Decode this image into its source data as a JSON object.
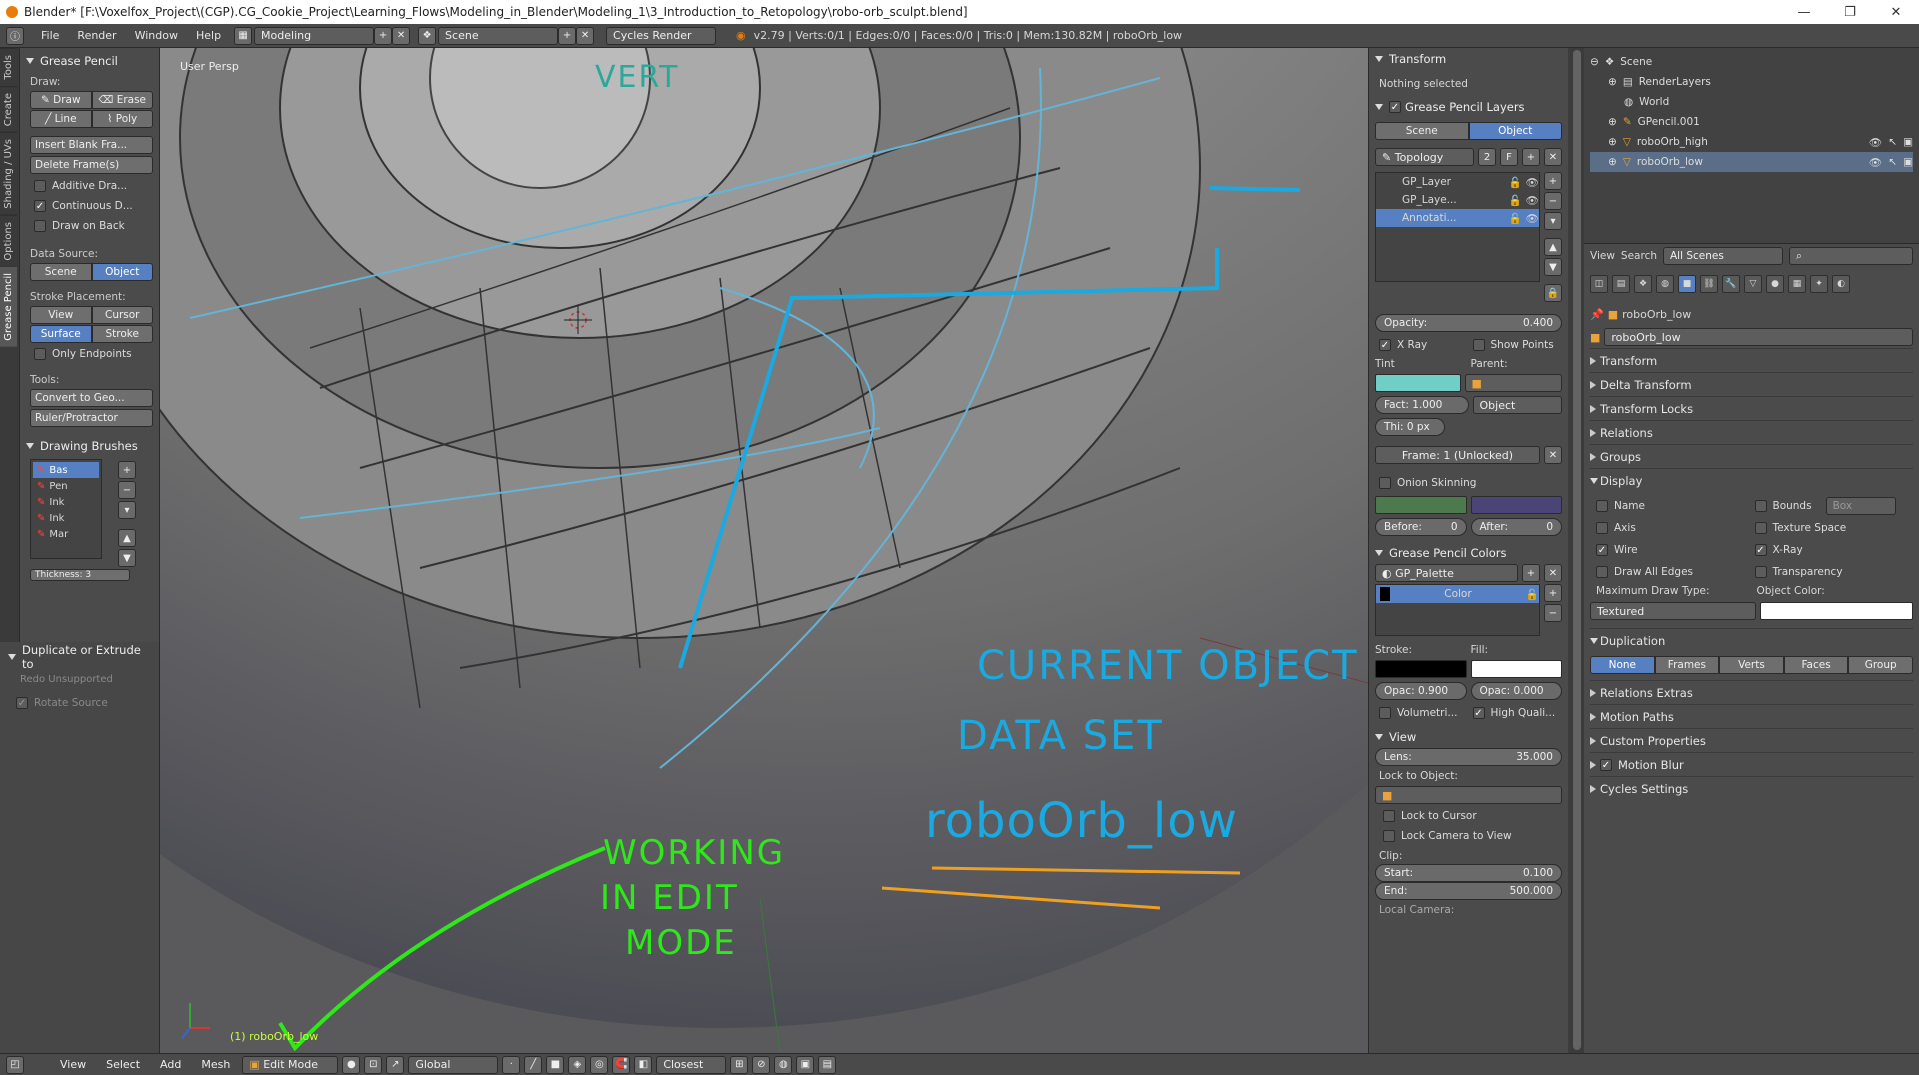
{
  "title_bar": {
    "text": "Blender* [F:\\Voxelfox_Project\\(CGP).CG_Cookie_Project\\Learning_Flows\\Modeling_in_Blender\\Modeling_1\\3_Introduction_to_Retopology\\robo-orb_sculpt.blend]",
    "min": "—",
    "max": "❐",
    "close": "✕"
  },
  "info_bar": {
    "menus": [
      "File",
      "Render",
      "Window",
      "Help"
    ],
    "layout": "Modeling",
    "scene": "Scene",
    "engine": "Cycles Render",
    "stats": "v2.79 | Verts:0/1 | Edges:0/0 | Faces:0/0 | Tris:0 | Mem:130.82M | roboOrb_low"
  },
  "side_tabs": [
    "Tools",
    "Create",
    "Shading / UVs",
    "Options",
    "Grease Pencil"
  ],
  "tool_shelf": {
    "header": "Grease Pencil",
    "draw_label": "Draw:",
    "draw": "Draw",
    "erase": "Erase",
    "line": "Line",
    "poly": "Poly",
    "insert_blank": "Insert Blank Fra...",
    "delete_frames": "Delete Frame(s)",
    "additive": "Additive Dra...",
    "continuous": "Continuous D...",
    "draw_on_back": "Draw on Back",
    "data_source_label": "Data Source:",
    "ds_scene": "Scene",
    "ds_object": "Object",
    "stroke_label": "Stroke Placement:",
    "sp_view": "View",
    "sp_cursor": "Cursor",
    "sp_surface": "Surface",
    "sp_stroke": "Stroke",
    "only_endpoints": "Only Endpoints",
    "tools_label": "Tools:",
    "convert": "Convert to Geo...",
    "ruler": "Ruler/Protractor",
    "brushes_header": "Drawing Brushes",
    "brushes": [
      "Bas",
      "Pen",
      "Ink",
      "Ink",
      "Mar"
    ],
    "thickness": "Thickness: 3"
  },
  "operator_panel": {
    "header": "Duplicate or Extrude to",
    "redo": "Redo Unsupported",
    "rotate_source": "Rotate Source"
  },
  "viewport": {
    "view_label": "User Persp",
    "object_label": "(1) roboOrb_low",
    "scribble": "VERT",
    "note_current": "CURRENT OBJECT",
    "note_data": "DATA SET",
    "note_name": "roboOrb_low",
    "note_working": "WORKING",
    "note_in_edit": "IN EDIT",
    "note_mode": "MODE"
  },
  "n_panel": {
    "transform_header": "Transform",
    "nothing_selected": "Nothing selected",
    "gp_layers_header": "Grease Pencil Layers",
    "tab_scene": "Scene",
    "tab_object": "Object",
    "gp_name": "Topology",
    "gp_users": "2",
    "gp_f": "F",
    "layers": [
      "GP_Layer",
      "GP_Laye...",
      "Annotati..."
    ],
    "opacity_label": "Opacity:",
    "opacity_value": "0.400",
    "xray": "X Ray",
    "show_points": "Show Points",
    "tint_label": "Tint",
    "parent_label": "Parent:",
    "fact": "Fact: 1.000",
    "parent_type": "Object",
    "thickness": "Thi: 0 px",
    "frame": "Frame: 1 (Unlocked)",
    "onion": "Onion Skinning",
    "before": "Before:",
    "before_val": "0",
    "after": "After:",
    "after_val": "0",
    "colors_header": "Grease Pencil Colors",
    "palette": "GP_Palette",
    "color_item": "Color",
    "stroke_label": "Stroke:",
    "fill_label": "Fill:",
    "stroke_opac": "Opac: 0.900",
    "fill_opac": "Opac: 0.000",
    "volumetric": "Volumetri...",
    "hq": "High Quali...",
    "view_header": "View",
    "lens_label": "Lens:",
    "lens_value": "35.000",
    "lock_obj": "Lock to Object:",
    "lock_cursor": "Lock to Cursor",
    "lock_camera": "Lock Camera to View",
    "clip_label": "Clip:",
    "start_label": "Start:",
    "start_value": "0.100",
    "end_label": "End:",
    "end_value": "500.000",
    "local_camera": "Local Camera:"
  },
  "outliner": {
    "items": [
      "Scene",
      "RenderLayers",
      "World",
      "GPencil.001",
      "roboOrb_high",
      "roboOrb_low"
    ],
    "view": "View",
    "search": "Search",
    "filter": "All Scenes"
  },
  "properties": {
    "object": "roboOrb_low",
    "name_field": "roboOrb_low",
    "sections": [
      "Transform",
      "Delta Transform",
      "Transform Locks",
      "Relations",
      "Groups"
    ],
    "display_header": "Display",
    "display": {
      "name": "Name",
      "bounds": "Bounds",
      "bounds_type": "Box",
      "axis": "Axis",
      "texture_space": "Texture Space",
      "wire": "Wire",
      "xray": "X-Ray",
      "draw_all_edges": "Draw All Edges",
      "transparency": "Transparency",
      "max_draw_label": "Maximum Draw Type:",
      "max_draw": "Textured",
      "obj_color_label": "Object Color:"
    },
    "duplication_header": "Duplication",
    "dup_tabs": [
      "None",
      "Frames",
      "Verts",
      "Faces",
      "Group"
    ],
    "more_sections": [
      "Relations Extras",
      "Motion Paths",
      "Custom Properties",
      "Motion Blur",
      "Cycles Settings"
    ]
  },
  "bottom_bar": {
    "menus": [
      "View",
      "Select",
      "Add",
      "Mesh"
    ],
    "mode": "Edit Mode",
    "orientation": "Global",
    "snap": "Closest"
  },
  "colors": {
    "accent": "#5680c2",
    "tint": "#6fcfc7",
    "onion_before": "#4d7a4d",
    "onion_after": "#4a4577",
    "note_blue": "#1aa9e0",
    "note_green": "#2ee81a",
    "note_orange": "#f0a020"
  }
}
